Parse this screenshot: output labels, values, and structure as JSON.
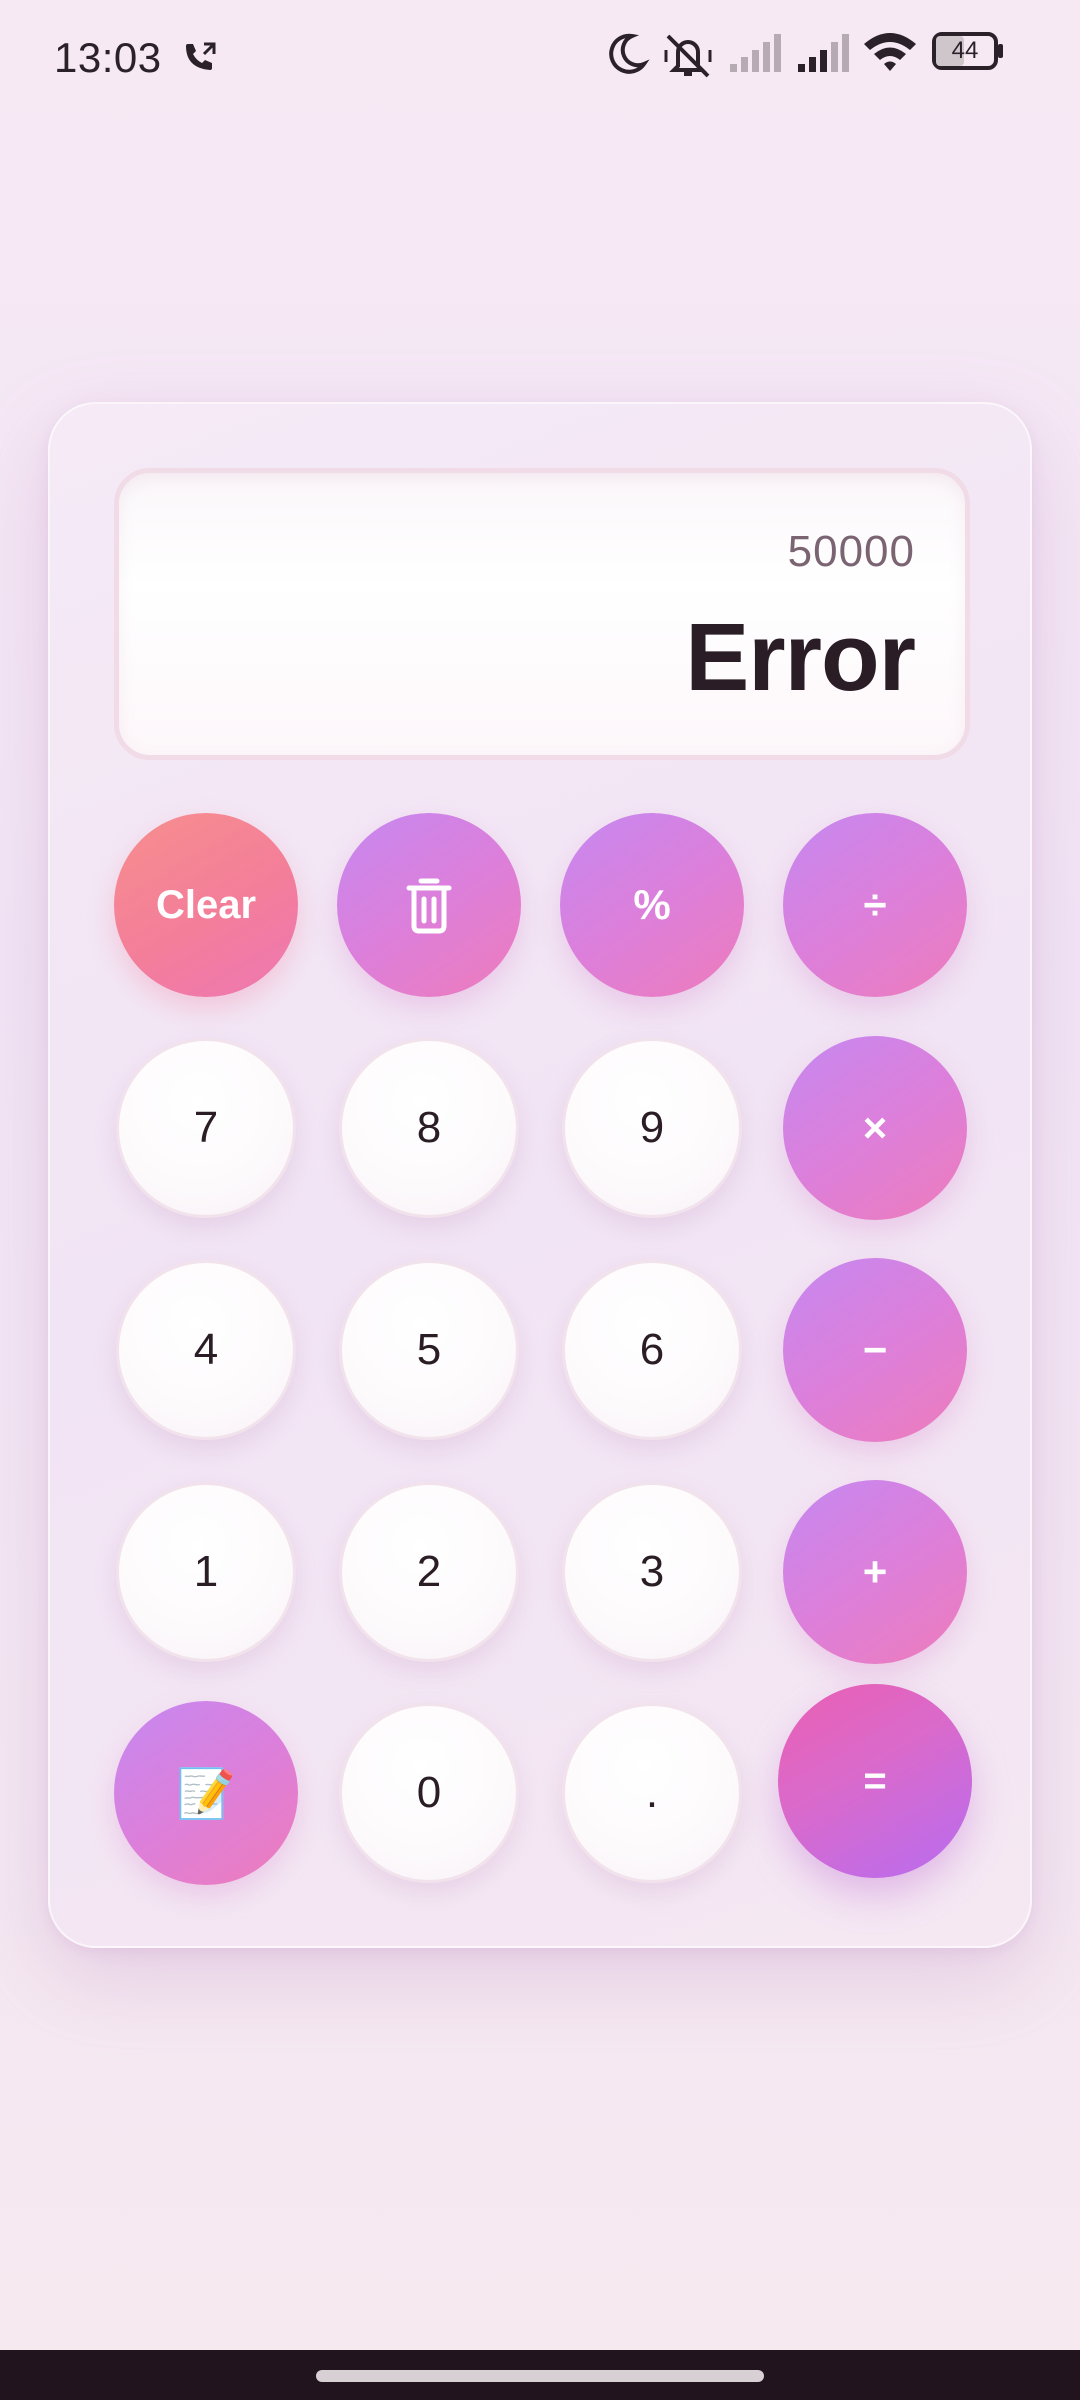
{
  "status_bar": {
    "time": "13:03",
    "battery": "44",
    "icons": [
      "call-forward-icon",
      "moon-icon",
      "vibrate-off-icon",
      "signal-weak-icon",
      "signal-icon",
      "wifi-icon",
      "battery-icon"
    ]
  },
  "display": {
    "expression": "50000",
    "result": "Error"
  },
  "buttons": {
    "clear": "Clear",
    "delete_icon": "trash-icon",
    "percent": "%",
    "divide": "÷",
    "multiply": "×",
    "subtract": "−",
    "add": "+",
    "equals": "=",
    "dot": ".",
    "n0": "0",
    "n1": "1",
    "n2": "2",
    "n3": "3",
    "n4": "4",
    "n5": "5",
    "n6": "6",
    "n7": "7",
    "n8": "8",
    "n9": "9",
    "note": "📝"
  },
  "colors": {
    "accent_start": "#c588f0",
    "accent_end": "#ee7cbb",
    "clear_start": "#f78e8e",
    "equals_end": "#b86cf0"
  }
}
